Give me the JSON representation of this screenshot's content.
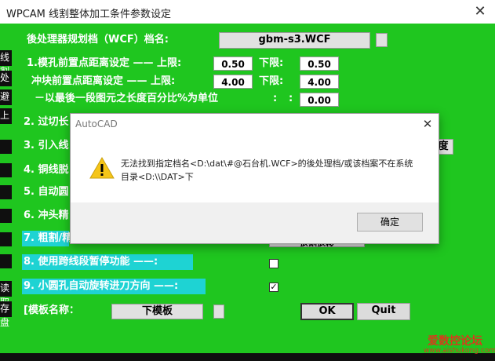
{
  "window": {
    "title": "WPCAM 线割整体加工条件参数设定",
    "close_glyph": "✕"
  },
  "backdrop": {
    "left_labels": [
      "线割",
      "处",
      "避",
      "上",
      "",
      "",
      "",
      "",
      "",
      "",
      "读取",
      "存盘"
    ],
    "right_fragment": "度"
  },
  "post_processor": {
    "label": "後处理器规划档（WCF）档名:",
    "value": "gbm-s3.WCF"
  },
  "rows": {
    "r1": {
      "label": "1.模孔前置点距离设定 ——  上限:",
      "upper": "0.50",
      "lower_label": "下限:",
      "lower": "0.50"
    },
    "r1b": {
      "label": "冲块前置点距离设定 ——  上限:",
      "upper": "4.00",
      "lower_label": "下限:",
      "lower": "4.00"
    },
    "r1c": {
      "label": "－以最後一段图元之长度百分比%为单位",
      "colon": ":",
      "value": "0.00"
    },
    "r2": "2. 过切长",
    "r3": "3. 引入线",
    "r4": "4. 铜线脱",
    "r5": "5. 自动圆",
    "r6": "6. 冲头精",
    "r7": "7. 粗割/精",
    "r8": "8. 使用跨线段暂停功能      ——:",
    "r9": "9. 小圆孔自动旋转进刀方向 ——:",
    "r7_button": "退割退移"
  },
  "checkboxes": {
    "r8_checked": false,
    "r9_checked": true
  },
  "template": {
    "label": "[模板名称：",
    "value": "下模板"
  },
  "buttons": {
    "ok": "OK",
    "quit": "Quit"
  },
  "dialog": {
    "title": "AutoCAD",
    "close_glyph": "✕",
    "message_line1": "无法找到指定档名<D:\\dat\\#@石台机.WCF>的後处理档/或该档案不在系统",
    "message_line2": "目录<D:\\\\DAT>下",
    "confirm": "确定",
    "icon": "warning-icon"
  },
  "watermark": {
    "text": "爱数控论坛",
    "url": "www.aishukong.com"
  },
  "colors": {
    "green": "#1fc61f",
    "cyan": "#1ed3d3",
    "warning": "#f5c518"
  }
}
